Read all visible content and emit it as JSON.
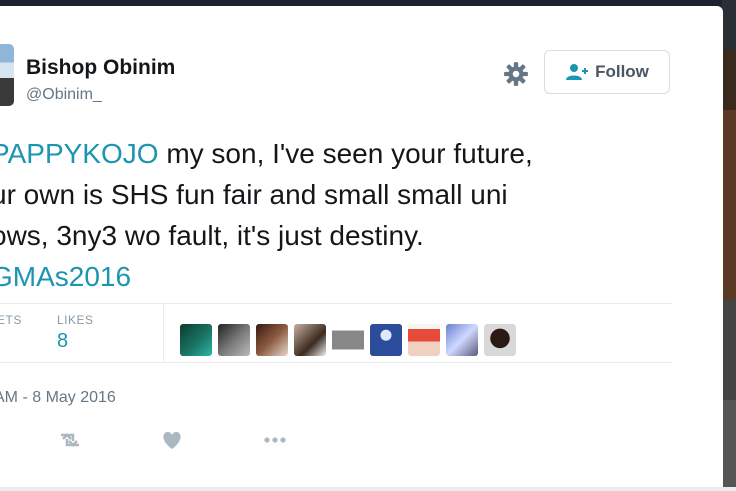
{
  "user": {
    "name": "Bishop Obinim",
    "handle": "@Obinim_"
  },
  "follow": {
    "label": "Follow"
  },
  "tweet": {
    "lines": [
      {
        "hash": "PAPPYKOJO",
        "rest": " my son, I've seen your future,"
      },
      {
        "text": "ur own is SHS fun fair and small small uni"
      },
      {
        "text": "ows, 3ny3 wo fault, it's just destiny."
      },
      {
        "hash": "GMAs2016",
        "rest": ""
      }
    ]
  },
  "stats": {
    "retweets_label": "ETS",
    "likes_label": "LIKES",
    "likes_value": "8"
  },
  "timestamp": "AM - 8 May 2016",
  "icons": [
    "settings-gear-icon",
    "follow-user-icon",
    "retweet-icon",
    "like-heart-icon",
    "more-icon"
  ],
  "colors": {
    "link": "#1b95b0",
    "muted": "#8899a6",
    "text": "#14171a"
  }
}
